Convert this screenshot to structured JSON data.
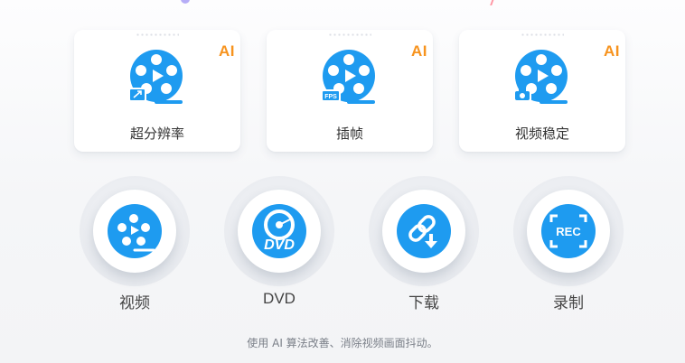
{
  "colors": {
    "brand_blue": "#1e9bf0",
    "ai_orange": "#f7931e"
  },
  "ai_cards": [
    {
      "label": "超分辨率",
      "badge": "AI",
      "icon": "film-reel-upscale-icon"
    },
    {
      "label": "插帧",
      "badge": "AI",
      "icon": "film-reel-fps-icon",
      "icon_text": "FPS"
    },
    {
      "label": "视频稳定",
      "badge": "AI",
      "icon": "film-reel-stabilize-icon"
    }
  ],
  "tools": [
    {
      "label": "视频",
      "icon": "film-reel-icon"
    },
    {
      "label": "DVD",
      "icon": "dvd-icon",
      "icon_text": "DVD"
    },
    {
      "label": "下载",
      "icon": "link-download-icon"
    },
    {
      "label": "录制",
      "icon": "rec-icon",
      "icon_text": "REC"
    }
  ],
  "footer": {
    "hint": "使用 AI 算法改善、消除视频画面抖动。"
  }
}
